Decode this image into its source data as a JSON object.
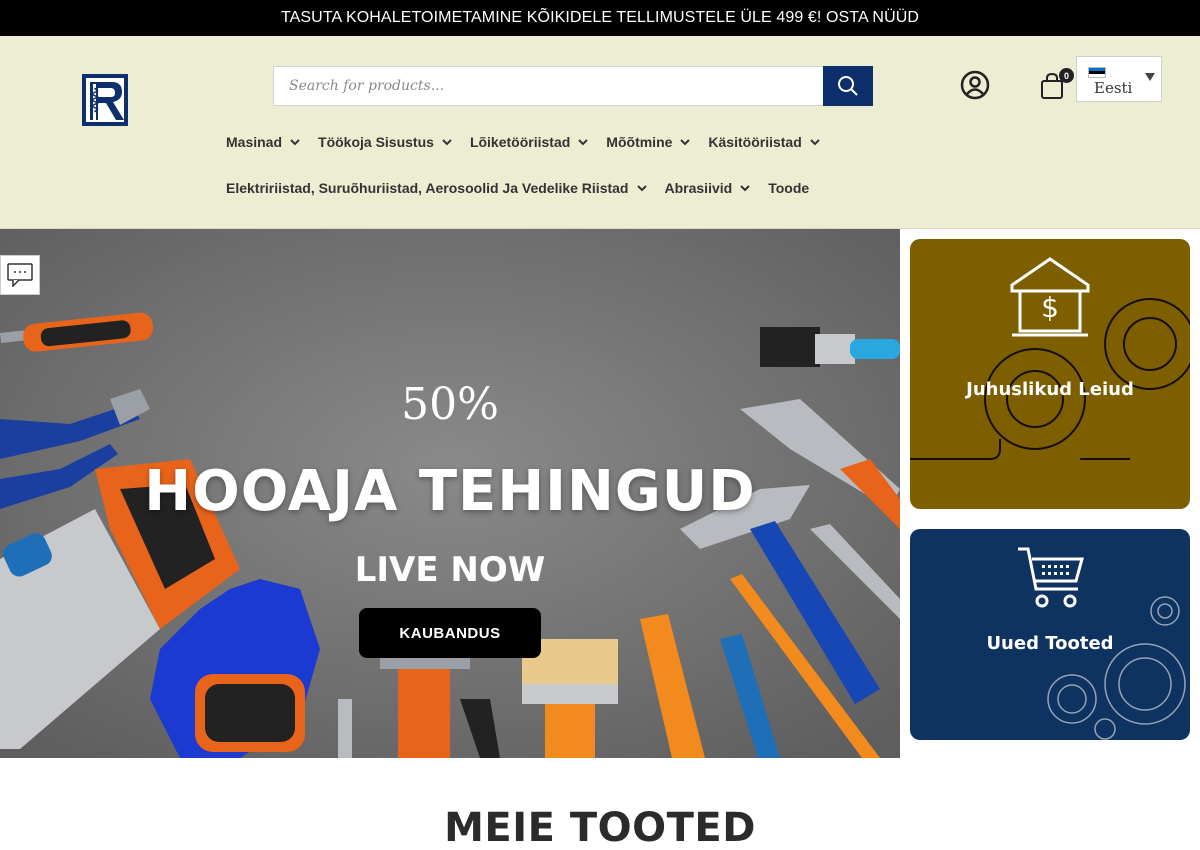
{
  "announcement": "TASUTA KOHALETOIMETAMINE KÕIKIDELE TELLIMUSTELE ÜLE 499 €! OSTA NÜÜD",
  "search": {
    "placeholder": "Search for products..."
  },
  "cart": {
    "count": "0"
  },
  "language": {
    "label": "Eesti",
    "flag_colors": [
      "#0072ce",
      "#000000",
      "#ffffff"
    ]
  },
  "nav": {
    "row1": [
      {
        "label": "Masinad",
        "dropdown": true
      },
      {
        "label": "Töökoja Sisustus",
        "dropdown": true
      },
      {
        "label": "Lõiketööriistad",
        "dropdown": true
      },
      {
        "label": "Mõõtmine",
        "dropdown": true
      },
      {
        "label": "Käsitööriistad",
        "dropdown": true
      }
    ],
    "row2": [
      {
        "label": "Elektririistad, Suruõhuriistad, Aerosoolid Ja Vedelike Riistad",
        "dropdown": true
      },
      {
        "label": "Abrasiivid",
        "dropdown": true
      },
      {
        "label": "Toode",
        "dropdown": false
      }
    ]
  },
  "hero": {
    "percent": "50%",
    "title": "HOOAJA TEHINGUD",
    "subtitle": "LIVE NOW",
    "button": "KAUBANDUS"
  },
  "cards": [
    {
      "label": "Juhuslikud Leiud",
      "color": "#7e5f00",
      "icon": "house-dollar-icon"
    },
    {
      "label": "Uued Tooted",
      "color": "#0f3360",
      "icon": "shopping-cart-icon"
    }
  ],
  "section_title": "MEIE TOOTED",
  "colors": {
    "brand_blue": "#0d2f6c",
    "header_bg": "#ededd3"
  }
}
